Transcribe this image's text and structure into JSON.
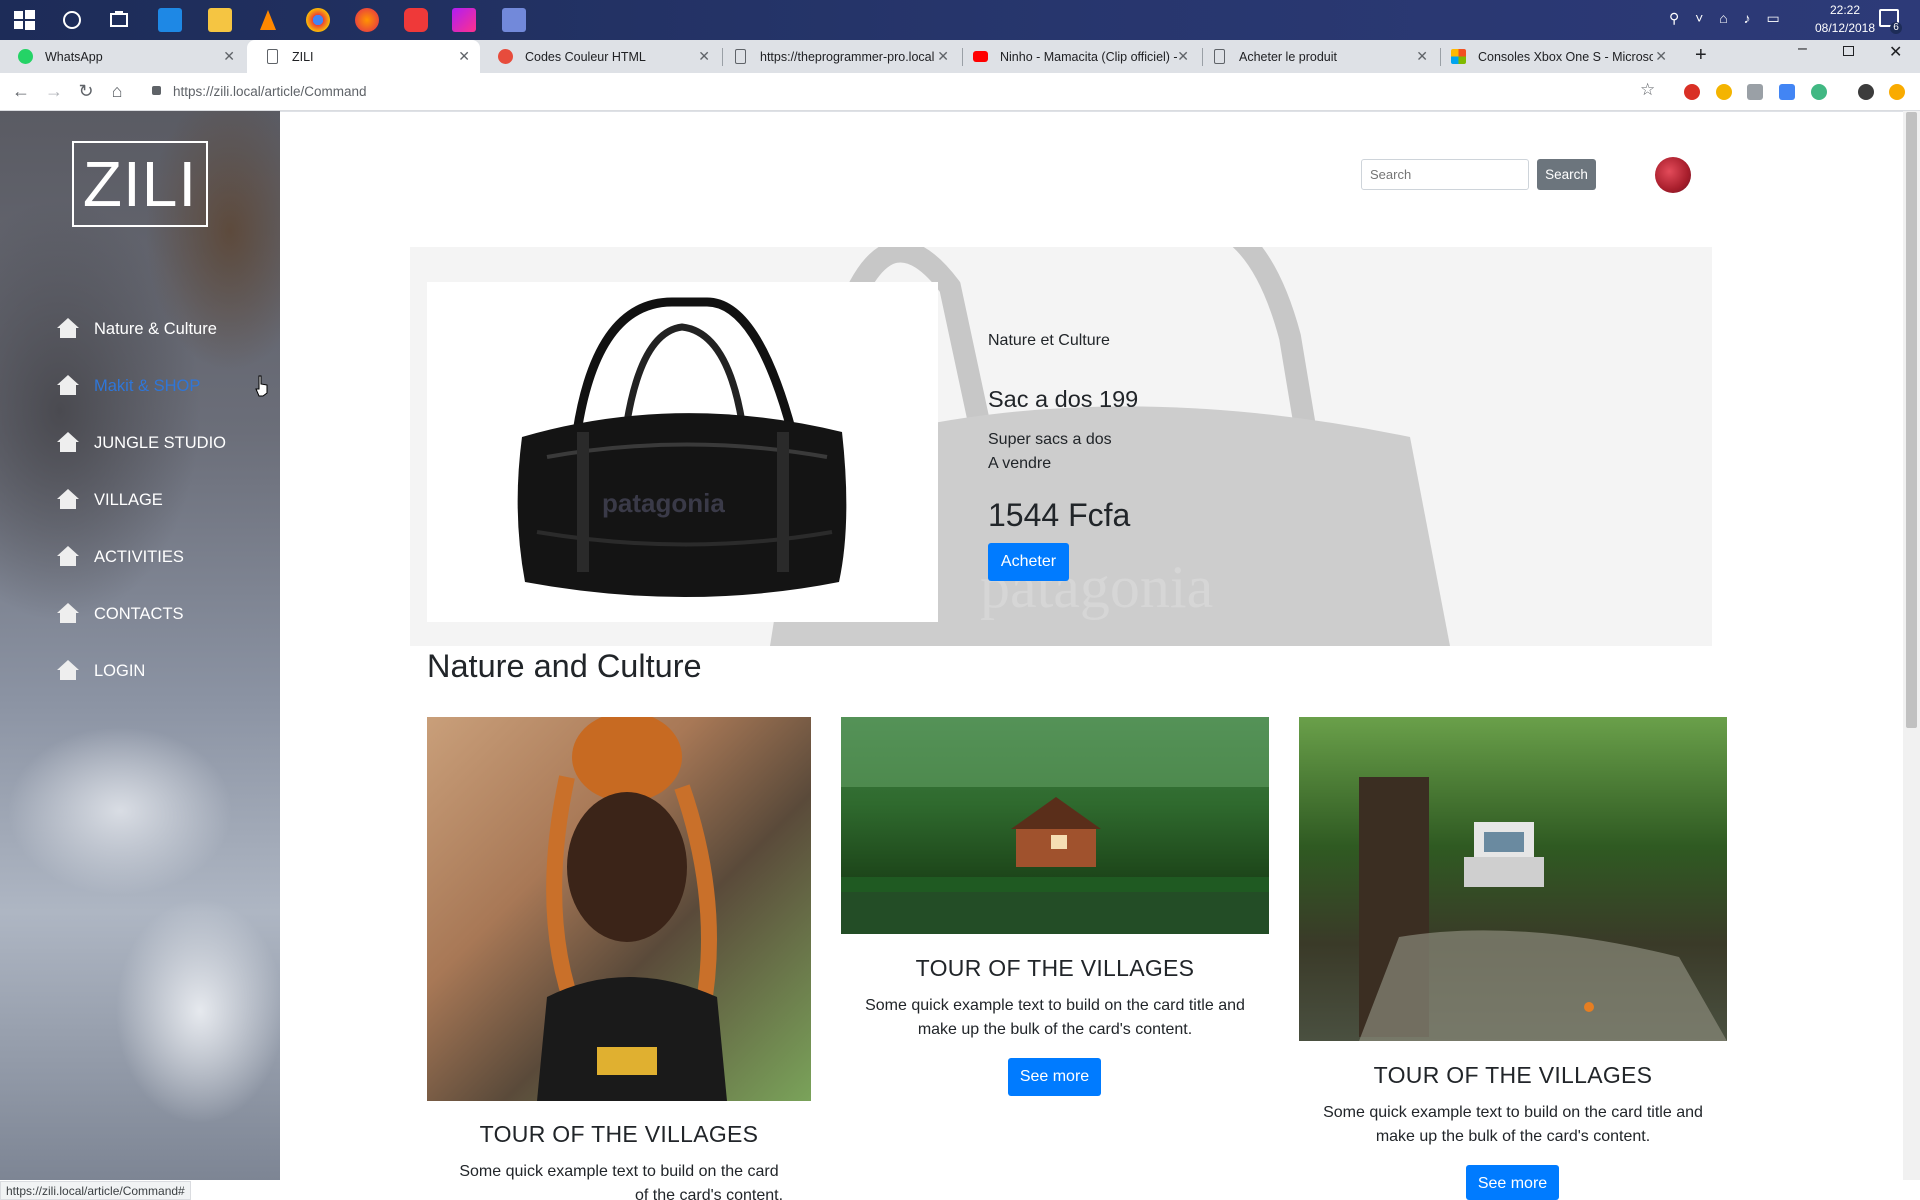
{
  "taskbar": {
    "time": "22:22",
    "date": "08/12/2018",
    "notification_count": "6"
  },
  "browser": {
    "tabs": [
      {
        "label": "WhatsApp"
      },
      {
        "label": "ZILI"
      },
      {
        "label": "Codes Couleur HTML"
      },
      {
        "label": "https://theprogrammer-pro.local"
      },
      {
        "label": "Ninho - Mamacita (Clip officiel) -"
      },
      {
        "label": "Acheter le produit"
      },
      {
        "label": "Consoles Xbox One S - Microsoft"
      }
    ],
    "url": "https://zili.local/article/Command",
    "status_url": "https://zili.local/article/Command#"
  },
  "sidebar": {
    "logo": "ZILI",
    "items": [
      {
        "label": "Nature & Culture"
      },
      {
        "label": "Makit & SHOP"
      },
      {
        "label": "JUNGLE STUDIO"
      },
      {
        "label": "VILLAGE"
      },
      {
        "label": "ACTIVITIES"
      },
      {
        "label": "CONTACTS"
      },
      {
        "label": "LOGIN"
      }
    ]
  },
  "header": {
    "search_placeholder": "Search",
    "search_button": "Search"
  },
  "product": {
    "category": "Nature et Culture",
    "title": "Sac a dos 199",
    "desc_line1": "Super sacs a dos",
    "desc_line2": "A vendre",
    "price": "1544 Fcfa",
    "buy_button": "Acheter",
    "watermark": "patagonia"
  },
  "section": {
    "title": "Nature and Culture"
  },
  "cards": [
    {
      "title": "TOUR OF THE VILLAGES",
      "text_line1": "Some quick example text to build on the card",
      "text_line2": "of the card's content."
    },
    {
      "title": "TOUR OF THE VILLAGES",
      "text_line1": "Some quick example text to build on the card title and",
      "text_line2": "make up the bulk of the card's content.",
      "button": "See more"
    },
    {
      "title": "TOUR OF THE VILLAGES",
      "text_line1": "Some quick example text to build on the card title and",
      "text_line2": "make up the bulk of the card's content.",
      "button": "See more"
    }
  ],
  "colors": {
    "primary": "#007bff",
    "sidebar_active": "#2f76d8",
    "search_button": "#6c757d"
  }
}
